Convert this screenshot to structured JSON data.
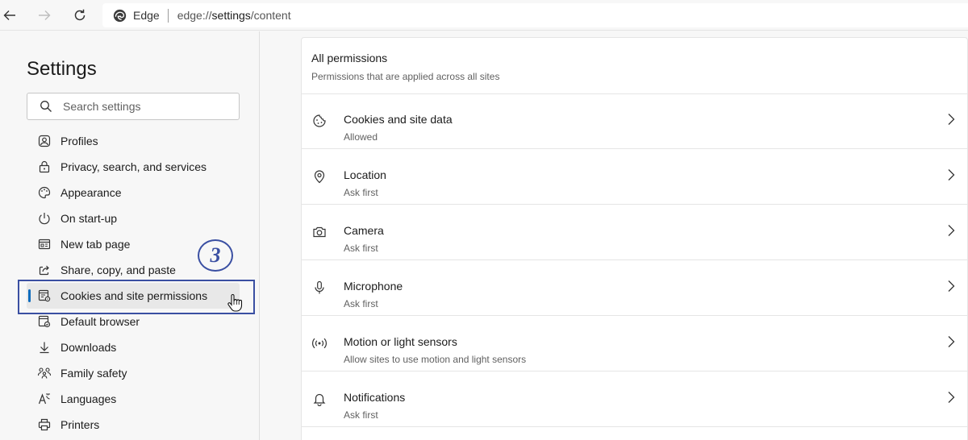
{
  "browser": {
    "site_name": "Edge",
    "url_prefix": "edge://",
    "url_host": "settings",
    "url_path": "/content"
  },
  "sidebar": {
    "title": "Settings",
    "search_placeholder": "Search settings",
    "items": [
      {
        "label": "Profiles",
        "icon": "profile-icon"
      },
      {
        "label": "Privacy, search, and services",
        "icon": "lock-icon"
      },
      {
        "label": "Appearance",
        "icon": "palette-icon"
      },
      {
        "label": "On start-up",
        "icon": "power-icon"
      },
      {
        "label": "New tab page",
        "icon": "newtab-icon"
      },
      {
        "label": "Share, copy, and paste",
        "icon": "share-icon"
      },
      {
        "label": "Cookies and site permissions",
        "icon": "cookie-settings-icon",
        "active": true
      },
      {
        "label": "Default browser",
        "icon": "browser-icon"
      },
      {
        "label": "Downloads",
        "icon": "download-icon"
      },
      {
        "label": "Family safety",
        "icon": "family-icon"
      },
      {
        "label": "Languages",
        "icon": "language-icon"
      },
      {
        "label": "Printers",
        "icon": "printer-icon"
      }
    ]
  },
  "annotation": {
    "step_number": "3"
  },
  "permissions": {
    "title": "All permissions",
    "subtitle": "Permissions that are applied across all sites",
    "items": [
      {
        "name": "Cookies and site data",
        "status": "Allowed",
        "icon": "cookie-icon"
      },
      {
        "name": "Location",
        "status": "Ask first",
        "icon": "location-icon"
      },
      {
        "name": "Camera",
        "status": "Ask first",
        "icon": "camera-icon"
      },
      {
        "name": "Microphone",
        "status": "Ask first",
        "icon": "microphone-icon"
      },
      {
        "name": "Motion or light sensors",
        "status": "Allow sites to use motion and light sensors",
        "icon": "sensor-icon"
      },
      {
        "name": "Notifications",
        "status": "Ask first",
        "icon": "bell-icon"
      }
    ]
  },
  "colors": {
    "accent": "#0f6cbd",
    "annotation": "#3a4fa2"
  }
}
